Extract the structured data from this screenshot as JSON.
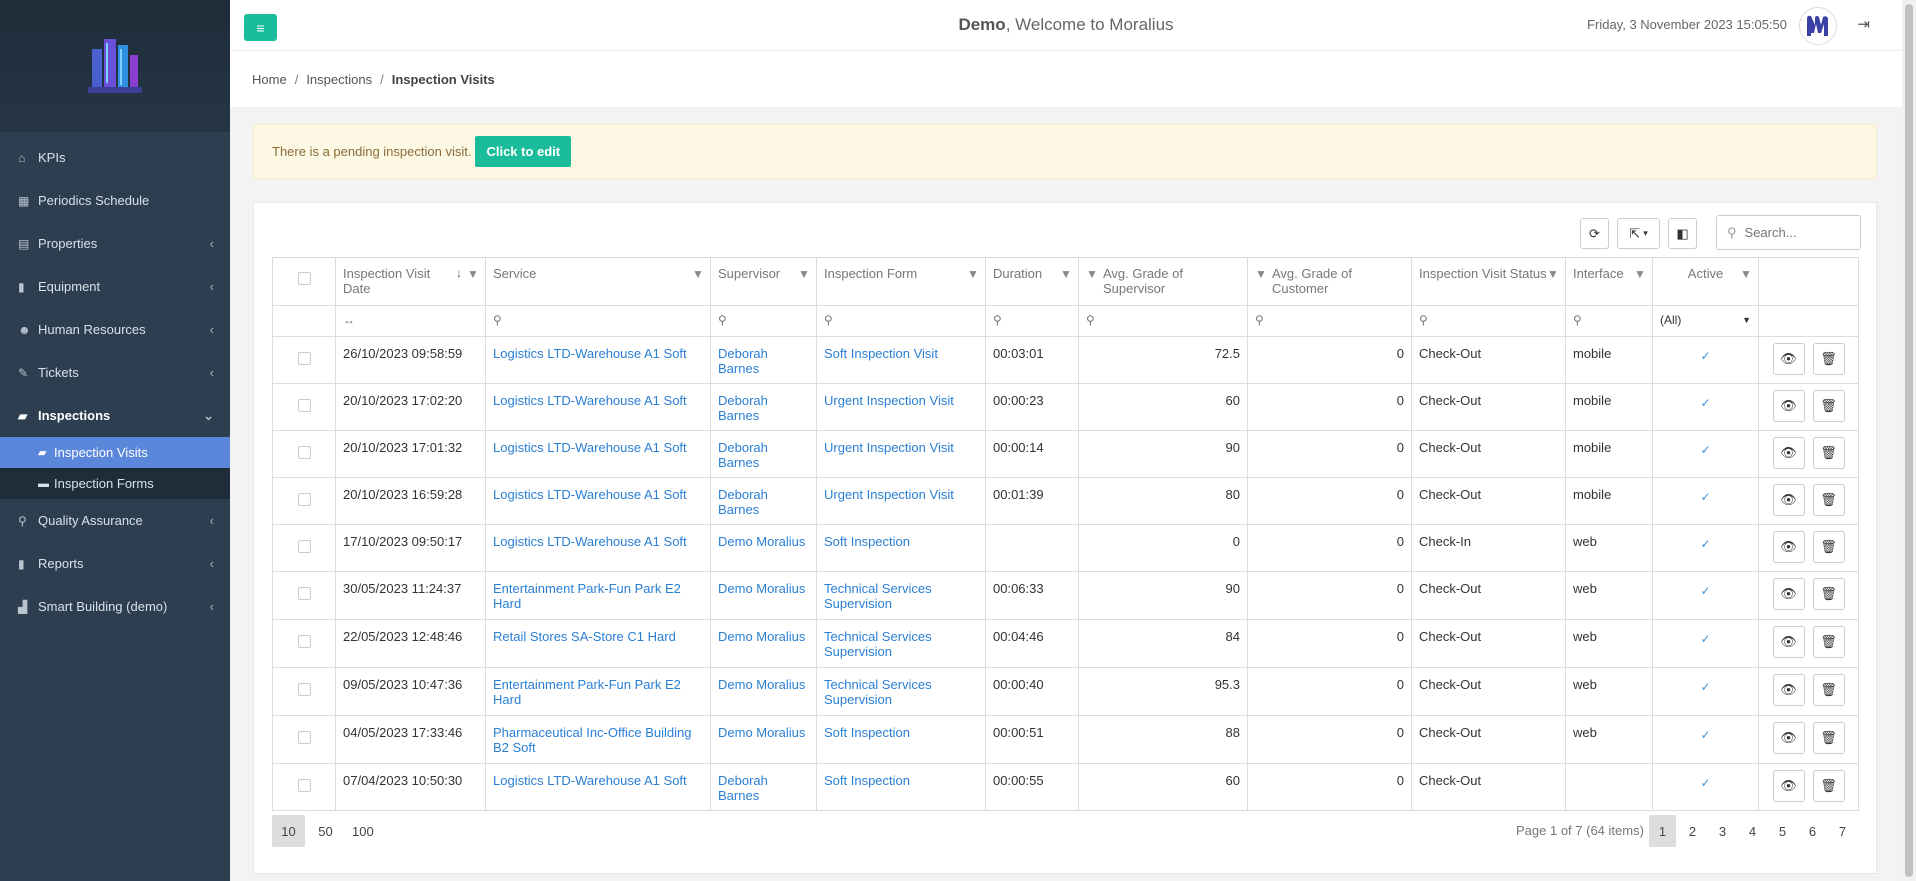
{
  "header": {
    "user": "Demo",
    "welcome": ", Welcome to Moralius",
    "datetime": "Friday, 3 November 2023 15:05:50"
  },
  "sidebar": {
    "items": [
      {
        "label": "KPIs",
        "icon": "home-icon",
        "glyph": "⌂",
        "chevron": false
      },
      {
        "label": "Periodics Schedule",
        "icon": "calendar-icon",
        "glyph": "▦",
        "chevron": false
      },
      {
        "label": "Properties",
        "icon": "building-icon",
        "glyph": "▤",
        "chevron": true
      },
      {
        "label": "Equipment",
        "icon": "book-icon",
        "glyph": "▮",
        "chevron": true
      },
      {
        "label": "Human Resources",
        "icon": "users-icon",
        "glyph": "👥",
        "chevron": true
      },
      {
        "label": "Tickets",
        "icon": "tools-icon",
        "glyph": "✎",
        "chevron": true
      },
      {
        "label": "Inspections",
        "icon": "map-icon",
        "glyph": "▰",
        "chevron": "down"
      },
      {
        "label": "Quality Assurance",
        "icon": "search-icon",
        "glyph": "⚲",
        "chevron": true
      },
      {
        "label": "Reports",
        "icon": "book-icon",
        "glyph": "▮",
        "chevron": true
      },
      {
        "label": "Smart Building (demo)",
        "icon": "chart-icon",
        "glyph": "▟",
        "chevron": true
      }
    ],
    "submenu": [
      {
        "label": "Inspection Visits",
        "icon": "map-icon",
        "active": true
      },
      {
        "label": "Inspection Forms",
        "icon": "folder-icon",
        "active": false
      }
    ]
  },
  "breadcrumb": [
    "Home",
    "Inspections",
    "Inspection Visits"
  ],
  "alert": {
    "text": "There is a pending inspection visit.",
    "button": "Click to edit"
  },
  "search": {
    "placeholder": "Search..."
  },
  "table": {
    "columns": [
      "Inspection Visit Date",
      "Service",
      "Supervisor",
      "Inspection Form",
      "Duration",
      "Avg. Grade of Supervisor",
      "Avg. Grade of Customer",
      "Inspection Visit Status",
      "Interface",
      "Active"
    ],
    "active_filter": "(All)",
    "rows": [
      [
        "26/10/2023 09:58:59",
        "Logistics LTD-Warehouse A1 Soft",
        "Deborah Barnes",
        "Soft Inspection Visit",
        "00:03:01",
        "72.5",
        "0",
        "Check-Out",
        "mobile"
      ],
      [
        "20/10/2023 17:02:20",
        "Logistics LTD-Warehouse A1 Soft",
        "Deborah Barnes",
        "Urgent Inspection Visit",
        "00:00:23",
        "60",
        "0",
        "Check-Out",
        "mobile"
      ],
      [
        "20/10/2023 17:01:32",
        "Logistics LTD-Warehouse A1 Soft",
        "Deborah Barnes",
        "Urgent Inspection Visit",
        "00:00:14",
        "90",
        "0",
        "Check-Out",
        "mobile"
      ],
      [
        "20/10/2023 16:59:28",
        "Logistics LTD-Warehouse A1 Soft",
        "Deborah Barnes",
        "Urgent Inspection Visit",
        "00:01:39",
        "80",
        "0",
        "Check-Out",
        "mobile"
      ],
      [
        "17/10/2023 09:50:17",
        "Logistics LTD-Warehouse A1 Soft",
        "Demo Moralius",
        "Soft Inspection",
        "",
        "0",
        "0",
        "Check-In",
        "web"
      ],
      [
        "30/05/2023 11:24:37",
        "Entertainment Park-Fun Park E2 Hard",
        "Demo Moralius",
        "Technical Services Supervision",
        "00:06:33",
        "90",
        "0",
        "Check-Out",
        "web"
      ],
      [
        "22/05/2023 12:48:46",
        "Retail Stores SA-Store C1 Hard",
        "Demo Moralius",
        "Technical Services Supervision",
        "00:04:46",
        "84",
        "0",
        "Check-Out",
        "web"
      ],
      [
        "09/05/2023 10:47:36",
        "Entertainment Park-Fun Park E2 Hard",
        "Demo Moralius",
        "Technical Services Supervision",
        "00:00:40",
        "95.3",
        "0",
        "Check-Out",
        "web"
      ],
      [
        "04/05/2023 17:33:46",
        "Pharmaceutical Inc-Office Building B2 Soft",
        "Demo Moralius",
        "Soft Inspection",
        "00:00:51",
        "88",
        "0",
        "Check-Out",
        "web"
      ],
      [
        "07/04/2023 10:50:30",
        "Logistics LTD-Warehouse A1 Soft",
        "Deborah Barnes",
        "Soft Inspection",
        "00:00:55",
        "60",
        "0",
        "Check-Out",
        ""
      ]
    ]
  },
  "pager": {
    "sizes": [
      "10",
      "50",
      "100"
    ],
    "selected_size": "10",
    "info": "Page 1 of 7 (64 items)",
    "pages": [
      "1",
      "2",
      "3",
      "4",
      "5",
      "6",
      "7"
    ],
    "current_page": "1"
  },
  "colors": {
    "accent": "#1abc9c",
    "sidebar": "#2c3e50",
    "active": "#5b87da",
    "link": "#2a7fd4"
  }
}
